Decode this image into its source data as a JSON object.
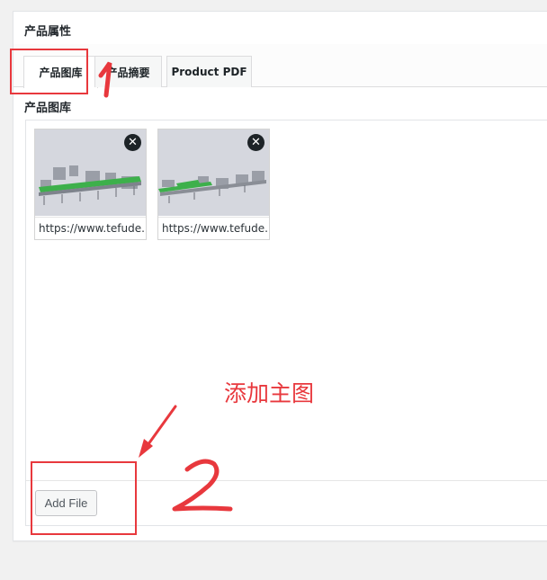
{
  "panel": {
    "title": "产品属性",
    "tabs": [
      {
        "label": "产品图库",
        "active": true
      },
      {
        "label": "产品摘要",
        "active": false
      },
      {
        "label": "Product PDF",
        "active": false
      }
    ]
  },
  "gallery": {
    "section_label": "产品图库",
    "files": [
      {
        "url": "https://www.tefude.",
        "remove_icon": "close-icon"
      },
      {
        "url": "https://www.tefude.",
        "remove_icon": "close-icon"
      }
    ],
    "add_button_label": "Add File"
  },
  "annotations": {
    "step_1": "1",
    "step_2": "2",
    "note": "添加主图",
    "color": "#e8383d"
  }
}
